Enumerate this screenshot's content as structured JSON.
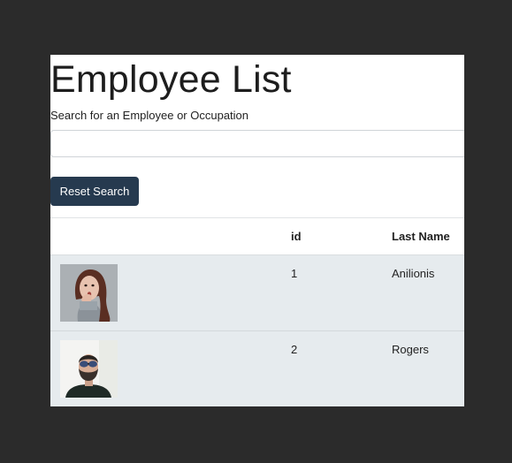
{
  "page": {
    "title": "Employee List"
  },
  "search": {
    "label": "Search for an Employee or Occupation",
    "value": "",
    "placeholder": ""
  },
  "reset_button": {
    "label": "Reset Search"
  },
  "table": {
    "columns": [
      "",
      "id",
      "Last Name"
    ],
    "rows": [
      {
        "id": "1",
        "last_name": "Anilionis",
        "image": "portrait-surprised-woman"
      },
      {
        "id": "2",
        "last_name": "Rogers",
        "image": "portrait-man-sunglasses"
      }
    ]
  },
  "colors": {
    "background": "#2b2b2b",
    "button": "#263a4f",
    "row_striped": "#e6ebee"
  }
}
